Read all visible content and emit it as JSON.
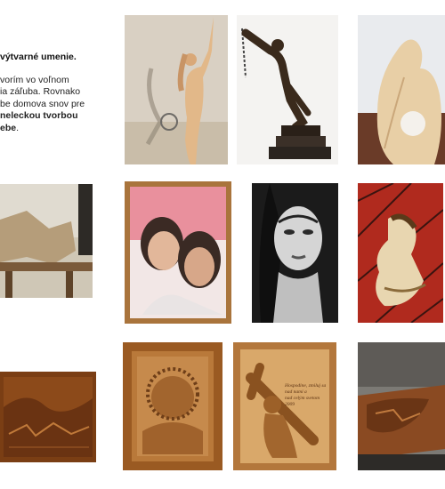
{
  "intro": {
    "heading": "výtvarné umenie.",
    "line1": "vorím vo voľnom",
    "line2": "ia záľuba. Rovnako",
    "line3": "be domova snov pre",
    "line4_bold": "neleckou tvorbou",
    "line5_bold": "ebe",
    "line5_rest": "."
  },
  "gallery": {
    "row1": [
      "female-figure-wood-sculpture",
      "chained-man-bronze-sculpture",
      "abstract-wood-couple-sculpture"
    ],
    "row2": [
      "relief-carving-on-workbench",
      "woodburned-portrait-two-girls",
      "pencil-portrait-woman",
      "stained-glass-style-woman-painting"
    ],
    "row3": [
      "carved-wooden-board-panorama",
      "carved-relief-christ-crown-of-thorns",
      "carved-relief-christ-carrying-cross",
      "carved-rifle-stock"
    ],
    "relief_inscription": [
      "Hospodine, zmiluj sa",
      "nad nami a",
      "nad celým svetom",
      "2009"
    ]
  },
  "colors": {
    "wood_light": "#e7c99a",
    "wood_mid": "#b8763a",
    "wood_dark": "#5b3216",
    "bronze": "#3a2a1c",
    "stained_red": "#b02a1e"
  }
}
